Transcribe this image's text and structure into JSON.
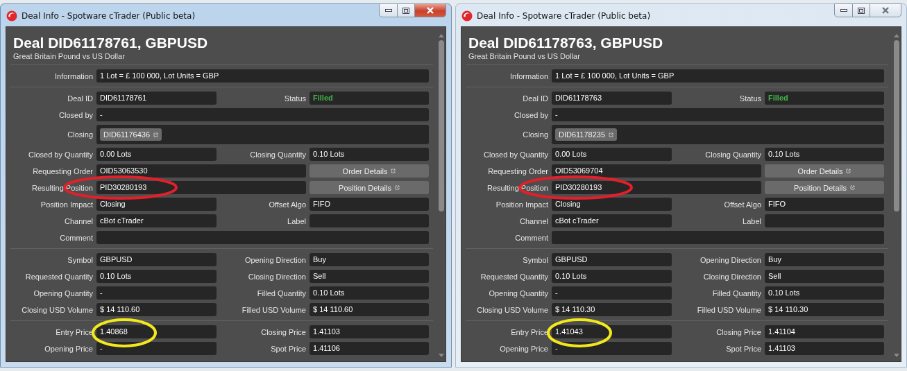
{
  "windows": [
    {
      "title": "Deal Info - Spotware cTrader (Public beta)",
      "active": true,
      "heading": "Deal DID61178761, GBPUSD",
      "subheading": "Great Britain Pound vs US Dollar",
      "sections": [
        [
          {
            "kind": "wide",
            "label": "Information",
            "value": "1 Lot = £ 100 000, Lot Units = GBP"
          }
        ],
        [
          {
            "kind": "pair",
            "left": {
              "label": "Deal ID",
              "value": "DID61178761"
            },
            "right": {
              "label": "Status",
              "value": "Filled",
              "color": "#43b649"
            }
          },
          {
            "kind": "wide",
            "label": "Closed by",
            "value": "-"
          },
          {
            "kind": "chip",
            "label": "Closing",
            "value": "DID61176436"
          },
          {
            "kind": "pair",
            "left": {
              "label": "Closed by Quantity",
              "value": "0.00 Lots"
            },
            "right": {
              "label": "Closing Quantity",
              "value": "0.10 Lots"
            }
          },
          {
            "kind": "button",
            "label": "Requesting Order",
            "value": "OID53063530",
            "button": "Order Details"
          },
          {
            "kind": "button",
            "label": "Resulting Position",
            "value": "PID30280193",
            "button": "Position Details",
            "annotation": {
              "kind": "ellipse",
              "color": "#e0202a"
            }
          },
          {
            "kind": "pair",
            "left": {
              "label": "Position Impact",
              "value": "Closing"
            },
            "right": {
              "label": "Offset Algo",
              "value": "FIFO"
            }
          },
          {
            "kind": "pair",
            "left": {
              "label": "Channel",
              "value": "cBot cTrader"
            },
            "right": {
              "label": "Label"
            }
          },
          {
            "kind": "wide",
            "label": "Comment"
          }
        ],
        [
          {
            "kind": "pair",
            "left": {
              "label": "Symbol",
              "value": "GBPUSD"
            },
            "right": {
              "label": "Opening Direction",
              "value": "Buy"
            }
          },
          {
            "kind": "pair",
            "left": {
              "label": "Requested Quantity",
              "value": "0.10 Lots"
            },
            "right": {
              "label": "Closing Direction",
              "value": "Sell"
            }
          },
          {
            "kind": "pair",
            "left": {
              "label": "Opening Quantity",
              "value": "-"
            },
            "right": {
              "label": "Filled Quantity",
              "value": "0.10 Lots"
            }
          },
          {
            "kind": "pair",
            "left": {
              "label": "Closing USD Volume",
              "value": "$ 14 110.60"
            },
            "right": {
              "label": "Filled USD Volume",
              "value": "$ 14 110.60"
            }
          }
        ],
        [
          {
            "kind": "pair",
            "left": {
              "label": "Entry Price",
              "value": "1.40868"
            },
            "right": {
              "label": "Closing Price",
              "value": "1.41103"
            },
            "annotation": {
              "kind": "ellipse",
              "color": "#f2e81c"
            }
          },
          {
            "kind": "pair",
            "left": {
              "label": "Opening Price",
              "value": "-"
            },
            "right": {
              "label": "Spot Price",
              "value": "1.41106"
            }
          }
        ]
      ]
    },
    {
      "title": "Deal Info - Spotware cTrader (Public beta)",
      "active": false,
      "heading": "Deal DID61178763, GBPUSD",
      "subheading": "Great Britain Pound vs US Dollar",
      "sections": [
        [
          {
            "kind": "wide",
            "label": "Information",
            "value": "1 Lot = £ 100 000, Lot Units = GBP"
          }
        ],
        [
          {
            "kind": "pair",
            "left": {
              "label": "Deal ID",
              "value": "DID61178763"
            },
            "right": {
              "label": "Status",
              "value": "Filled",
              "color": "#43b649"
            }
          },
          {
            "kind": "wide",
            "label": "Closed by",
            "value": "-"
          },
          {
            "kind": "chip",
            "label": "Closing",
            "value": "DID61178235"
          },
          {
            "kind": "pair",
            "left": {
              "label": "Closed by Quantity",
              "value": "0.00 Lots"
            },
            "right": {
              "label": "Closing Quantity",
              "value": "0.10 Lots"
            }
          },
          {
            "kind": "button",
            "label": "Requesting Order",
            "value": "OID53069704",
            "button": "Order Details"
          },
          {
            "kind": "button",
            "label": "Resulting Position",
            "value": "PID30280193",
            "button": "Position Details",
            "annotation": {
              "kind": "ellipse",
              "color": "#e0202a"
            }
          },
          {
            "kind": "pair",
            "left": {
              "label": "Position Impact",
              "value": "Closing"
            },
            "right": {
              "label": "Offset Algo",
              "value": "FIFO"
            }
          },
          {
            "kind": "pair",
            "left": {
              "label": "Channel",
              "value": "cBot cTrader"
            },
            "right": {
              "label": "Label"
            }
          },
          {
            "kind": "wide",
            "label": "Comment"
          }
        ],
        [
          {
            "kind": "pair",
            "left": {
              "label": "Symbol",
              "value": "GBPUSD"
            },
            "right": {
              "label": "Opening Direction",
              "value": "Buy"
            }
          },
          {
            "kind": "pair",
            "left": {
              "label": "Requested Quantity",
              "value": "0.10 Lots"
            },
            "right": {
              "label": "Closing Direction",
              "value": "Sell"
            }
          },
          {
            "kind": "pair",
            "left": {
              "label": "Opening Quantity",
              "value": "-"
            },
            "right": {
              "label": "Filled Quantity",
              "value": "0.10 Lots"
            }
          },
          {
            "kind": "pair",
            "left": {
              "label": "Closing USD Volume",
              "value": "$ 14 110.30"
            },
            "right": {
              "label": "Filled USD Volume",
              "value": "$ 14 110.30"
            }
          }
        ],
        [
          {
            "kind": "pair",
            "left": {
              "label": "Entry Price",
              "value": "1.41043"
            },
            "right": {
              "label": "Closing Price",
              "value": "1.41104"
            },
            "annotation": {
              "kind": "ellipse",
              "color": "#f2e81c"
            }
          },
          {
            "kind": "pair",
            "left": {
              "label": "Opening Price",
              "value": "-"
            },
            "right": {
              "label": "Spot Price",
              "value": "1.41103"
            }
          }
        ]
      ]
    }
  ]
}
